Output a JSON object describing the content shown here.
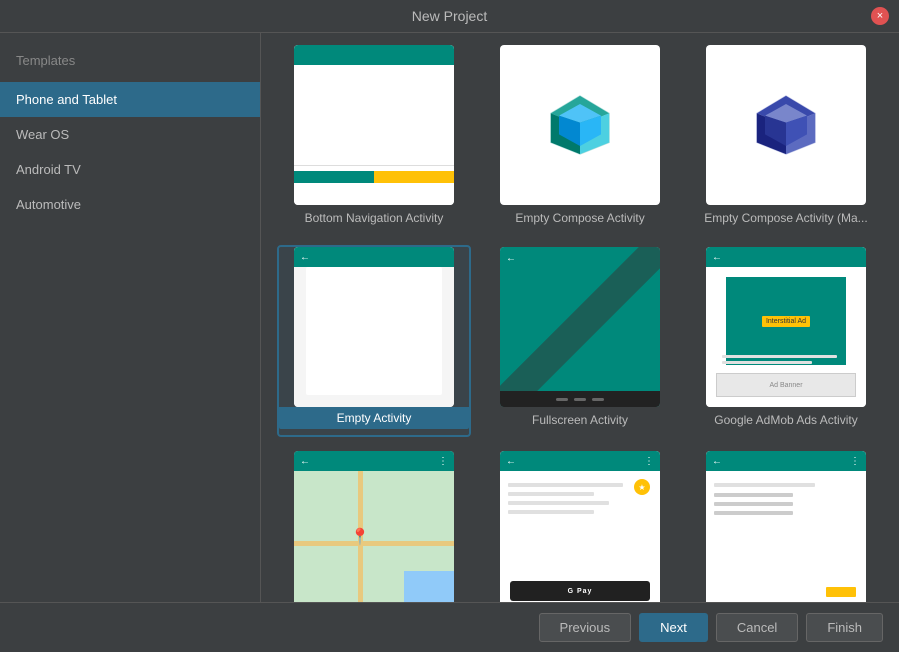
{
  "dialog": {
    "title": "New Project",
    "close_label": "×"
  },
  "sidebar": {
    "section_label": "Templates",
    "items": [
      {
        "id": "phone-tablet",
        "label": "Phone and Tablet",
        "active": true
      },
      {
        "id": "wear-os",
        "label": "Wear OS",
        "active": false
      },
      {
        "id": "android-tv",
        "label": "Android TV",
        "active": false
      },
      {
        "id": "automotive",
        "label": "Automotive",
        "active": false
      }
    ]
  },
  "templates": [
    {
      "id": "bottom-nav",
      "label": "Bottom Navigation Activity",
      "selected": false
    },
    {
      "id": "empty-compose",
      "label": "Empty Compose Activity",
      "selected": false
    },
    {
      "id": "empty-compose-ma",
      "label": "Empty Compose Activity (Ma...",
      "selected": false
    },
    {
      "id": "empty-activity",
      "label": "Empty Activity",
      "selected": true
    },
    {
      "id": "fullscreen",
      "label": "Fullscreen Activity",
      "selected": false
    },
    {
      "id": "admob",
      "label": "Google AdMob Ads Activity",
      "selected": false
    },
    {
      "id": "maps",
      "label": "",
      "selected": false
    },
    {
      "id": "subscription",
      "label": "",
      "selected": false
    },
    {
      "id": "settings",
      "label": "",
      "selected": false
    }
  ],
  "footer": {
    "previous_label": "Previous",
    "next_label": "Next",
    "cancel_label": "Cancel",
    "finish_label": "Finish"
  }
}
